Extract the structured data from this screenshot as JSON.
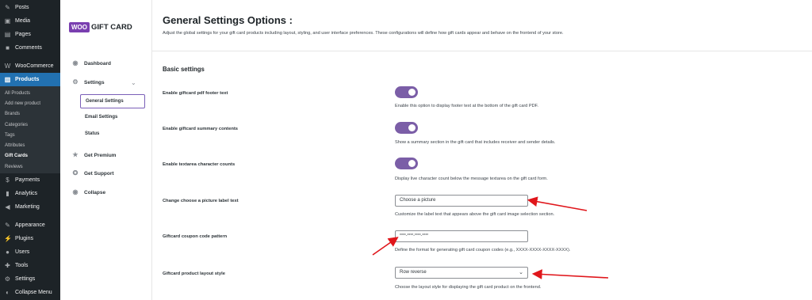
{
  "wp_menu": {
    "items": [
      {
        "label": "Posts",
        "icon": "pin-icon"
      },
      {
        "label": "Media",
        "icon": "media-icon"
      },
      {
        "label": "Pages",
        "icon": "pages-icon"
      },
      {
        "label": "Comments",
        "icon": "comments-icon"
      },
      {
        "label": "WooCommerce",
        "icon": "woocommerce-icon"
      },
      {
        "label": "Products",
        "icon": "products-icon"
      }
    ],
    "products_sub": [
      "All Products",
      "Add new product",
      "Brands",
      "Categories",
      "Tags",
      "Attributes",
      "Gift Cards",
      "Reviews"
    ],
    "items2": [
      {
        "label": "Payments",
        "icon": "payments-icon"
      },
      {
        "label": "Analytics",
        "icon": "analytics-icon"
      },
      {
        "label": "Marketing",
        "icon": "marketing-icon"
      }
    ],
    "items3": [
      {
        "label": "Appearance",
        "icon": "appearance-icon"
      },
      {
        "label": "Plugins",
        "icon": "plugins-icon"
      },
      {
        "label": "Users",
        "icon": "users-icon"
      },
      {
        "label": "Tools",
        "icon": "tools-icon"
      },
      {
        "label": "Settings",
        "icon": "settings-icon"
      },
      {
        "label": "Collapse Menu",
        "icon": "collapse-icon"
      }
    ]
  },
  "plugin": {
    "logo_badge": "WOO",
    "logo_text": "GIFT CARD",
    "nav": {
      "dashboard": "Dashboard",
      "settings": "Settings",
      "general": "General Settings",
      "email": "Email Settings",
      "status": "Status",
      "premium": "Get Premium",
      "support": "Get Support",
      "collapse": "Collapse"
    }
  },
  "page": {
    "title": "General Settings Options :",
    "description": "Adjust the global settings for your gift card products including layout, styling, and user interface preferences. These configurations will define how gift cards appear and behave on the frontend of your store.",
    "section": "Basic settings"
  },
  "settings": [
    {
      "label": "Enable giftcard pdf footer text",
      "help": "Enable this option to display footer text at the bottom of the gift card PDF."
    },
    {
      "label": "Enable giftcard summary contents",
      "help": "Show a summary section in the gift card that includes receiver and sender details."
    },
    {
      "label": "Enable textarea character counts",
      "help": "Display live character count below the message textarea on the gift card form."
    },
    {
      "label": "Change choose a picture label text",
      "value": "Choose a picture",
      "help": "Customize the label text that appears above the gift card image selection section."
    },
    {
      "label": "Giftcard coupon code pattern",
      "value": "****-****-****-****",
      "help": "Define the format for generating gift card coupon codes (e.g., XXXX-XXXX-XXXX-XXXX)."
    },
    {
      "label": "Giftcard product layout style",
      "value": "Row reverse",
      "help": "Choose the layout style for displaying the gift card product on the frontend."
    }
  ],
  "colors": {
    "accent": "#7b5ea7",
    "wp_active": "#2271b1",
    "annotation": "#e0161b"
  }
}
